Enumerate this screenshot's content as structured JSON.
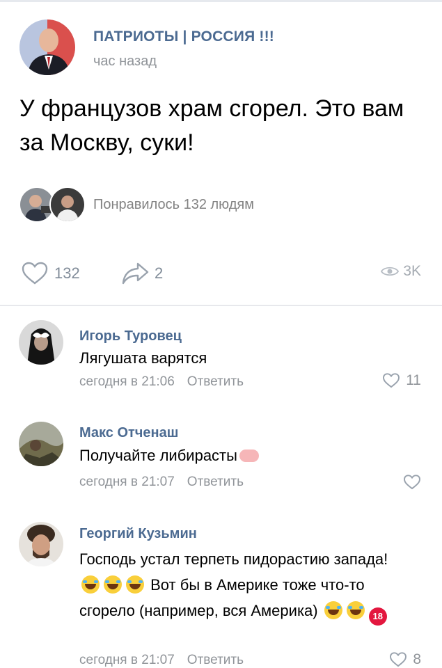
{
  "post": {
    "author": "ПАТРИОТЫ | РОССИЯ !!!",
    "time": "час назад",
    "text": "У французов храм сгорел. Это вам за Москву, суки!",
    "liked_text": "Понравилось 132 людям"
  },
  "actions": {
    "likes": "132",
    "shares": "2",
    "views": "3K"
  },
  "comments": [
    {
      "name": "Игорь Туровец",
      "text": "Лягушата варятся",
      "time": "сегодня в 21:06",
      "reply": "Ответить",
      "likes": "11"
    },
    {
      "name": "Макс Отченаш",
      "text": "Получайте либирасты",
      "emoji_after": "pig",
      "time": "сегодня в 21:07",
      "reply": "Ответить",
      "likes": ""
    },
    {
      "name": "Георгий Кузьмин",
      "text_part1": "Господь устал терпеть пидорастию запада!",
      "text_part2": "Вот бы в Америке тоже что-то сгорело (например, вся Америка)",
      "emoji": [
        "laugh",
        "laugh",
        "laugh",
        "laugh",
        "laugh",
        "18"
      ],
      "eighteen": "18",
      "time": "сегодня в 21:07",
      "reply": "Ответить",
      "likes": "8"
    }
  ],
  "colors": {
    "link": "#4b6a91",
    "secondary": "#909499",
    "icon": "#818c99"
  }
}
